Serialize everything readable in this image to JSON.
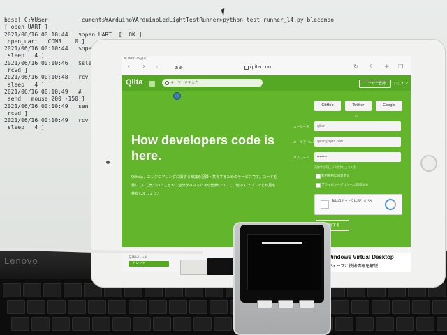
{
  "terminal": {
    "lines": [
      "base) C:¥User          cuments¥Arduino¥ArduinoLedLightTestRunner>python test-runner_l4.py blecombo",
      "[ open UART ]",
      "2021/06/16 00:10:44   $open UART  [  OK ]",
      " open_uart   COM3    0 ]",
      "2021/06/16 00:10:44   $open",
      " sleep   4 ]",
      "2021/06/16 00:10:46   $sle",
      " rcvd ]",
      "2021/06/16 00:10:48   rcv",
      " sleep   4 ]",
      "2021/06/16 00:10:49   #",
      " send   mouse 200 -150 ]",
      "2021/06/16 00:10:49   sen",
      " rcvd ]",
      "2021/06/16 00:10:49   rcv",
      " sleep   4 ]"
    ]
  },
  "laptop": {
    "brand": "Lenovo"
  },
  "safari": {
    "time": "9:16  6月16日(水)",
    "aa": "ぁあ",
    "url": "qiita.com",
    "icons": [
      "back-icon",
      "forward-icon",
      "sidebar-icon",
      "reload-icon",
      "share-icon",
      "new-tab-icon",
      "tabs-icon"
    ]
  },
  "qiita": {
    "logo": "Qiita",
    "search_placeholder": "キーワードを入力",
    "login_button": "ユーザー登録",
    "login_link": "ログイン",
    "hero_title": "How developers code is here.",
    "hero_description": "Qiitaは、エンジニアリングに関する知識を記録・共有するためのサービスです。コードを書いていて気づいたことや、自分がハマったあの仕様について、他のエンジニアと知見を共有しましょう;)",
    "social": [
      "GitHub",
      "Twitter",
      "Google"
    ],
    "or_text": "or",
    "form": {
      "username_label": "ユーザー名",
      "username_placeholder": "qiitan",
      "email_label": "メールアドレス",
      "email_placeholder": "qiitan@qiita.com",
      "password_label": "パスワード",
      "password_placeholder": "••••••••",
      "password_note": "英数字記号(_ -) 8文字以上で入力",
      "terms_label": "利用規約に同意する",
      "privacy_label": "プライバシーポリシーに同意する"
    },
    "recaptcha_text": "私はロボットではありません",
    "register_button": "登録する",
    "bottom_label": "記事トレンド",
    "trend_tab": "トレンド"
  },
  "ad": {
    "line1": "Windows Virtual Desktop",
    "line2": "ティープと技術情報を解説"
  },
  "colors": {
    "qiita_green": "#55c500",
    "terminal_bg": "#e9ecea"
  }
}
